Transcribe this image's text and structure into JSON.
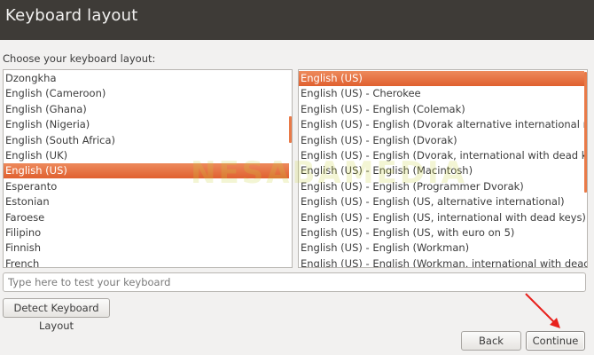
{
  "window": {
    "title": "Keyboard layout"
  },
  "prompt": "Choose your keyboard layout:",
  "layouts": [
    {
      "label": "Dzongkha",
      "selected": false
    },
    {
      "label": "English (Cameroon)",
      "selected": false
    },
    {
      "label": "English (Ghana)",
      "selected": false
    },
    {
      "label": "English (Nigeria)",
      "selected": false
    },
    {
      "label": "English (South Africa)",
      "selected": false
    },
    {
      "label": "English (UK)",
      "selected": false
    },
    {
      "label": "English (US)",
      "selected": true
    },
    {
      "label": "Esperanto",
      "selected": false
    },
    {
      "label": "Estonian",
      "selected": false
    },
    {
      "label": "Faroese",
      "selected": false
    },
    {
      "label": "Filipino",
      "selected": false
    },
    {
      "label": "Finnish",
      "selected": false
    },
    {
      "label": "French",
      "selected": false
    }
  ],
  "variants": [
    {
      "label": "English (US)",
      "selected": true
    },
    {
      "label": "English (US) - Cherokee",
      "selected": false
    },
    {
      "label": "English (US) - English (Colemak)",
      "selected": false
    },
    {
      "label": "English (US) - English (Dvorak alternative international no dead keys)",
      "selected": false
    },
    {
      "label": "English (US) - English (Dvorak)",
      "selected": false
    },
    {
      "label": "English (US) - English (Dvorak, international with dead keys)",
      "selected": false
    },
    {
      "label": "English (US) - English (Macintosh)",
      "selected": false
    },
    {
      "label": "English (US) - English (Programmer Dvorak)",
      "selected": false
    },
    {
      "label": "English (US) - English (US, alternative international)",
      "selected": false
    },
    {
      "label": "English (US) - English (US, international with dead keys)",
      "selected": false
    },
    {
      "label": "English (US) - English (US, with euro on 5)",
      "selected": false
    },
    {
      "label": "English (US) - English (Workman)",
      "selected": false
    },
    {
      "label": "English (US) - English (Workman, international with dead keys)",
      "selected": false
    }
  ],
  "test_input": {
    "placeholder": "Type here to test your keyboard",
    "value": ""
  },
  "buttons": {
    "detect": "Detect Keyboard Layout",
    "back": "Back",
    "continue": "Continue"
  },
  "watermark": "NESABAMEDIA",
  "colors": {
    "accent": "#e0602f",
    "titlebar": "#3e3b37",
    "annotation_arrow": "#e8211c"
  }
}
